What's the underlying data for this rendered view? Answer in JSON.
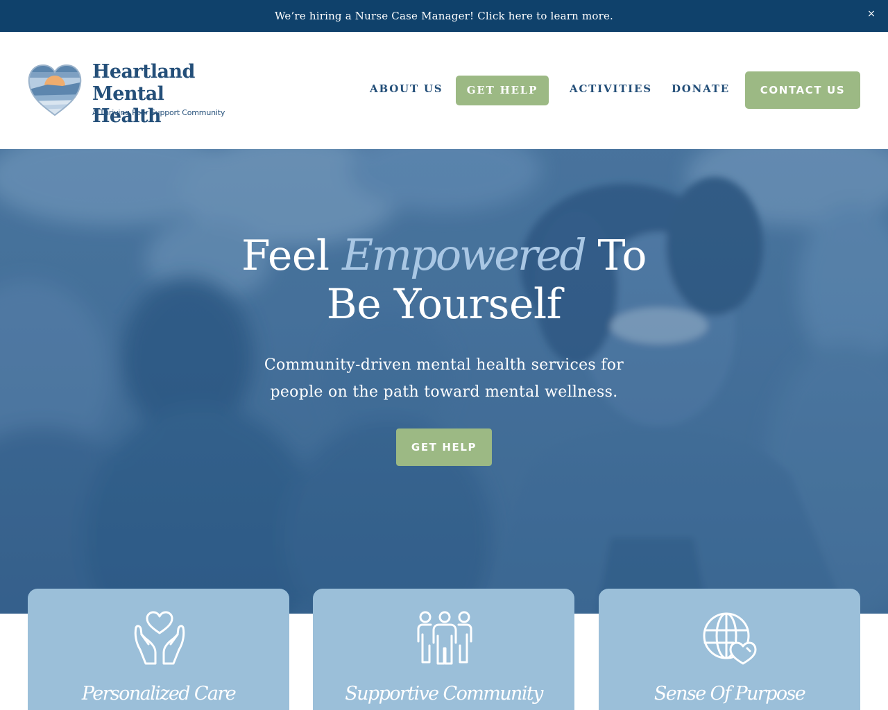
{
  "announcement": {
    "text": "We’re hiring a Nurse Case Manager! Click here to learn more.",
    "close_icon": "close-icon",
    "close_glyph": "×"
  },
  "logo": {
    "name_line1": "Heartland",
    "name_line2": "Mental Health",
    "tagline": "A Thriving Peer Support Community",
    "mark_icon": "heart-landscape-icon"
  },
  "nav": {
    "items": [
      {
        "label": "ABOUT US",
        "highlighted": false
      },
      {
        "label": "GET HELP",
        "highlighted": true
      },
      {
        "label": "ACTIVITIES",
        "highlighted": false
      },
      {
        "label": "DONATE",
        "highlighted": false
      }
    ],
    "contact_label": "CONTACT US"
  },
  "hero": {
    "title_word1": "Feel",
    "title_script": "Empowered",
    "title_word2": "To",
    "title_line2": "Be Yourself",
    "subtitle_line1": "Community-driven mental health services for",
    "subtitle_line2": "people on the path toward mental wellness.",
    "cta_label": "GET HELP"
  },
  "cards": [
    {
      "title": "Personalized Care",
      "icon": "hands-heart-icon"
    },
    {
      "title": "Supportive Community",
      "icon": "people-group-icon"
    },
    {
      "title": "Sense Of Purpose",
      "icon": "globe-heart-icon"
    }
  ],
  "colors": {
    "announcement_bg": "#0f416b",
    "brand_navy": "#244f79",
    "accent_green": "#9cb984",
    "hero_overlay": "#3d6791",
    "card_blue": "#9bbfd9",
    "script_blue": "#a9c7e4"
  }
}
